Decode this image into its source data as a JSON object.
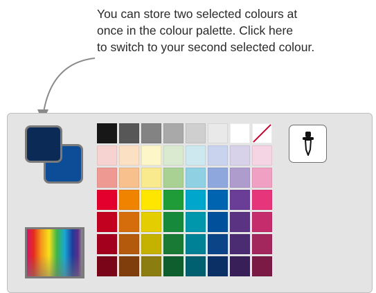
{
  "annotation": {
    "lines": [
      "You can store two selected colours at",
      "once in the colour palette. Click here",
      "to switch to your second selected colour."
    ]
  },
  "palette": {
    "primary_color": "#0b2a55",
    "secondary_color": "#0d4c97",
    "eyedropper_icon": "eyedropper-icon",
    "no_colour_icon": "no-colour-swatch",
    "rows": [
      [
        "#171717",
        "#575757",
        "#838383",
        "#a9a9a9",
        "#cfcfcf",
        "#e9e9e9",
        "#ffffff",
        "none"
      ],
      [
        "#f6d2d0",
        "#fbe0c4",
        "#fdf6c9",
        "#d9ead1",
        "#cde8ef",
        "#c9d3ee",
        "#d7d1ea",
        "#f5d4e4"
      ],
      [
        "#ee9a93",
        "#f7c08c",
        "#f8ea8d",
        "#a9d193",
        "#8fd0e3",
        "#8ea7dc",
        "#ae9ccd",
        "#f0a0c2"
      ],
      [
        "#e3002d",
        "#f08300",
        "#ffe600",
        "#1f9b38",
        "#00a6cc",
        "#0064b0",
        "#6a3d97",
        "#e6357a"
      ],
      [
        "#c2001f",
        "#d56d0d",
        "#e4cd00",
        "#168a3a",
        "#0096ab",
        "#00509c",
        "#5a3383",
        "#c42c6b"
      ],
      [
        "#a2001d",
        "#b35a0d",
        "#c4b100",
        "#197a35",
        "#008195",
        "#0b4588",
        "#4b2b72",
        "#a3265d"
      ],
      [
        "#7b0518",
        "#7f3e0b",
        "#8b7d0f",
        "#0f5e2d",
        "#00606f",
        "#0a3065",
        "#381f57",
        "#7a1a45"
      ]
    ]
  }
}
